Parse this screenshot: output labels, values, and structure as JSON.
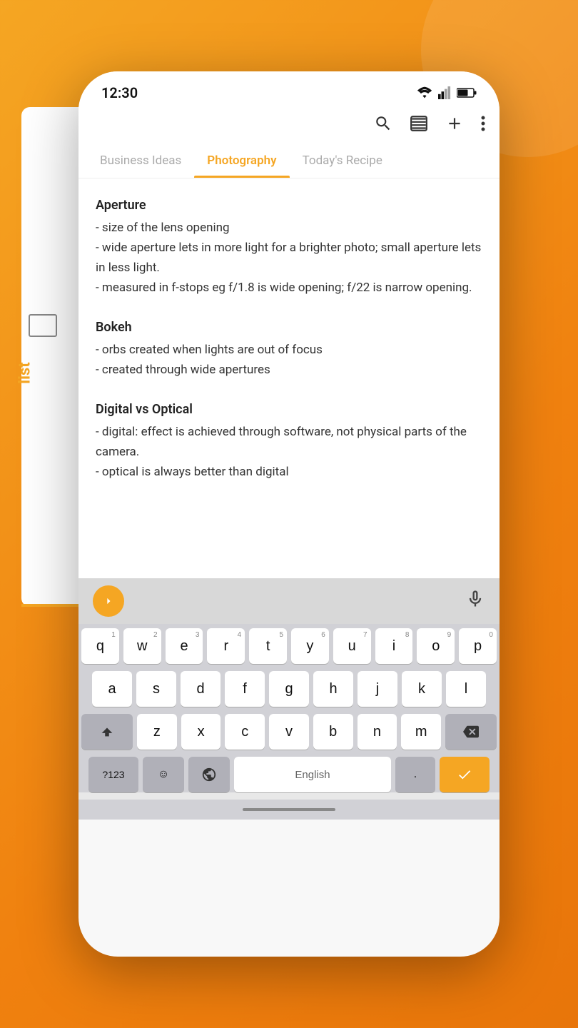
{
  "statusBar": {
    "time": "12:30"
  },
  "toolbar": {
    "searchIcon": "search",
    "tabsIcon": "tabs",
    "addIcon": "add",
    "moreIcon": "more"
  },
  "tabs": [
    {
      "id": "business",
      "label": "Business Ideas",
      "active": false
    },
    {
      "id": "photography",
      "label": "Photography",
      "active": true
    },
    {
      "id": "recipe",
      "label": "Today's Recipe",
      "active": false
    }
  ],
  "noteContent": {
    "sections": [
      {
        "title": "Aperture",
        "body": "- size of the lens opening\n- wide aperture lets in more light for a brighter photo; small aperture lets in less light.\n- measured in f-stops eg f/1.8 is wide opening; f/22 is narrow opening."
      },
      {
        "title": "Bokeh",
        "body": "- orbs created when lights are out of focus\n- created through wide apertures"
      },
      {
        "title": "Digital vs Optical",
        "body": "- digital: effect is achieved through software, not physical parts of the camera.\n- optical is always better than digital"
      }
    ]
  },
  "keyboard": {
    "rows": [
      [
        {
          "key": "q",
          "sup": "1"
        },
        {
          "key": "w",
          "sup": "2"
        },
        {
          "key": "e",
          "sup": "3"
        },
        {
          "key": "r",
          "sup": "4"
        },
        {
          "key": "t",
          "sup": "5"
        },
        {
          "key": "y",
          "sup": "6"
        },
        {
          "key": "u",
          "sup": "7"
        },
        {
          "key": "i",
          "sup": "8"
        },
        {
          "key": "o",
          "sup": "9"
        },
        {
          "key": "p",
          "sup": "0"
        }
      ],
      [
        {
          "key": "a"
        },
        {
          "key": "s"
        },
        {
          "key": "d"
        },
        {
          "key": "f"
        },
        {
          "key": "g"
        },
        {
          "key": "h"
        },
        {
          "key": "j"
        },
        {
          "key": "k"
        },
        {
          "key": "l"
        }
      ],
      [
        {
          "key": "⇧",
          "special": true
        },
        {
          "key": "z"
        },
        {
          "key": "x"
        },
        {
          "key": "c"
        },
        {
          "key": "v"
        },
        {
          "key": "b"
        },
        {
          "key": "n"
        },
        {
          "key": "m"
        },
        {
          "key": "⌫",
          "special": true
        }
      ],
      [
        {
          "key": "?123",
          "special": true
        },
        {
          "key": "☺,",
          "special": true
        },
        {
          "key": "🌐",
          "special": true
        },
        {
          "key": "English",
          "spacebar": true
        },
        {
          "key": ".",
          "special": true
        },
        {
          "key": "✓",
          "action": true
        }
      ]
    ],
    "spacebarLabel": "English"
  }
}
